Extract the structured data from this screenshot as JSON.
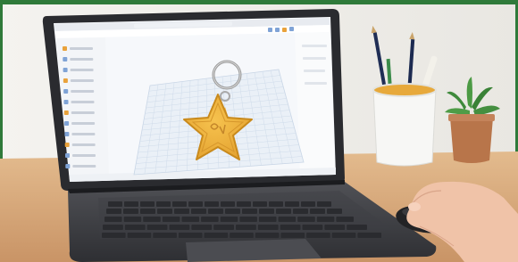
{
  "laptop": {
    "brand_label": "",
    "screen_app": {
      "left_panel_items": 12
    }
  },
  "colors": {
    "frame_green": "#2f7a3a",
    "star_fill": "#f0b33c",
    "star_stroke": "#c98a1c",
    "grid_line": "#c9d6e6",
    "desk": "#d7a878",
    "wall": "#f1f0ec",
    "laptop_body": "#3e3f44",
    "mouse": "#2a2a2c",
    "pencil_cup": "#f6f6f6",
    "pot": "#b8754a"
  }
}
